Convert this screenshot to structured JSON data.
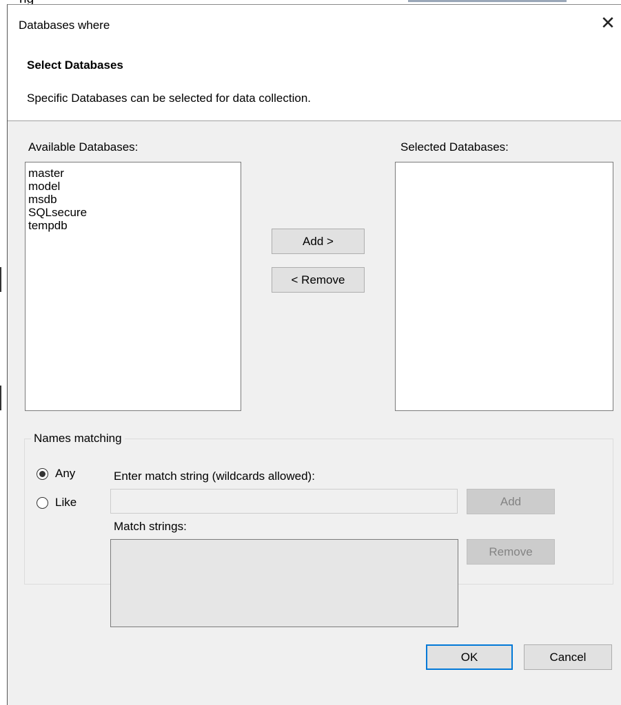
{
  "background_window": {
    "title_fragment": "ng"
  },
  "dialog": {
    "title": "Databases where",
    "close_glyph": "✕",
    "heading": "Select Databases",
    "subtitle": "Specific Databases can be selected for data collection."
  },
  "available": {
    "label": "Available Databases:",
    "items": [
      "master",
      "model",
      "msdb",
      "SQLsecure",
      "tempdb"
    ]
  },
  "selected": {
    "label": "Selected Databases:",
    "items": []
  },
  "transfer": {
    "add_label": "Add >",
    "remove_label": "< Remove"
  },
  "names_matching": {
    "legend": "Names matching",
    "any_label": "Any",
    "like_label": "Like",
    "selected_option": "Any",
    "match_string_label": "Enter match string (wildcards allowed):",
    "match_string_value": "",
    "add_label": "Add",
    "match_strings_label": "Match strings:",
    "remove_label": "Remove"
  },
  "footer": {
    "ok_label": "OK",
    "cancel_label": "Cancel"
  },
  "colors": {
    "dialog_bg": "#f0f0f0",
    "default_button_border": "#0078d7",
    "disabled_text": "#838383"
  }
}
